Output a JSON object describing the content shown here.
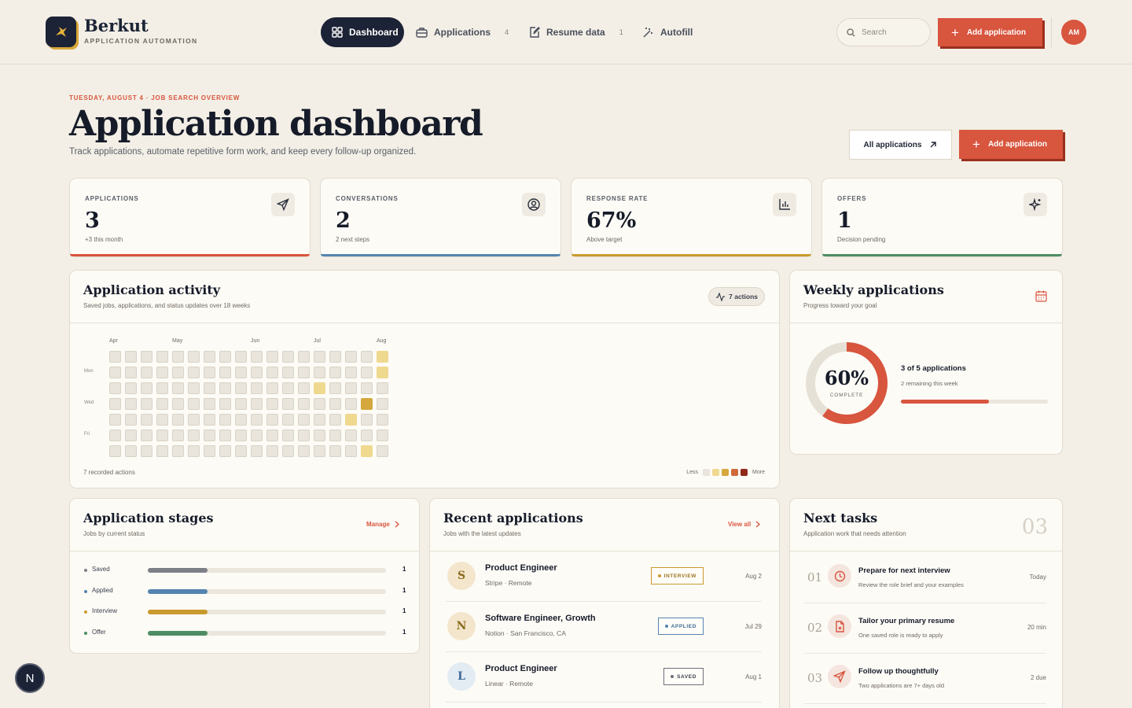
{
  "brand": {
    "name": "Berkut",
    "tagline": "APPLICATION AUTOMATION"
  },
  "nav": {
    "dashboard": "Dashboard",
    "applications": "Applications",
    "applications_count": "4",
    "resume": "Resume data",
    "resume_count": "1",
    "autofill": "Autofill"
  },
  "search": {
    "placeholder": "Search"
  },
  "header": {
    "add_label": "Add application",
    "avatar_initials": "AM"
  },
  "hero": {
    "eyebrow": "TUESDAY, AUGUST 4 · JOB SEARCH OVERVIEW",
    "title": "Application dashboard",
    "subtitle": "Track applications, automate repetitive form work, and keep every follow-up organized.",
    "all_label": "All applications",
    "add_label": "Add application"
  },
  "stats": [
    {
      "label": "APPLICATIONS",
      "value": "3",
      "sub": "+3 this month",
      "icon": "send-icon",
      "color": "#d8553e"
    },
    {
      "label": "CONVERSATIONS",
      "value": "2",
      "sub": "2 next steps",
      "icon": "user-circle-icon",
      "color": "#5584b0"
    },
    {
      "label": "RESPONSE RATE",
      "value": "67%",
      "sub": "Above target",
      "icon": "bar-chart-icon",
      "color": "#c99a2e"
    },
    {
      "label": "OFFERS",
      "value": "1",
      "sub": "Decision pending",
      "icon": "sparkle-icon",
      "color": "#4e8d63"
    }
  ],
  "activity": {
    "title": "Application activity",
    "sub": "Saved jobs, applications, and status updates over 18 weeks",
    "pill": "7 actions",
    "months": [
      "Apr",
      "May",
      "Jun",
      "Jul",
      "Aug"
    ],
    "days": [
      "Mon",
      "Wed",
      "Fri"
    ],
    "footer": "7 recorded actions",
    "legend_less": "Less",
    "legend_more": "More",
    "legend_colors": [
      "#e9e5dc",
      "#efd98f",
      "#d4a83d",
      "#cf6b3a",
      "#8f2a1a"
    ],
    "highlights": [
      {
        "week": 17,
        "day": 0,
        "level": 1
      },
      {
        "week": 17,
        "day": 1,
        "level": 1
      },
      {
        "week": 13,
        "day": 2,
        "level": 1
      },
      {
        "week": 16,
        "day": 3,
        "level": 2
      },
      {
        "week": 15,
        "day": 4,
        "level": 1
      },
      {
        "week": 16,
        "day": 6,
        "level": 1
      }
    ]
  },
  "weekly": {
    "title": "Weekly applications",
    "sub": "Progress toward your goal",
    "percent_label": "60%",
    "complete": "COMPLETE",
    "progress": 0.6,
    "headline": "3 of 5 applications",
    "remaining": "2 remaining this week"
  },
  "stages": {
    "title": "Application stages",
    "sub": "Jobs by current status",
    "manage": "Manage",
    "rows": [
      {
        "name": "Saved",
        "count": "1",
        "fraction": 0.25,
        "color": "#7d7f86"
      },
      {
        "name": "Applied",
        "count": "1",
        "fraction": 0.25,
        "color": "#5584b0"
      },
      {
        "name": "Interview",
        "count": "1",
        "fraction": 0.25,
        "color": "#c99a2e"
      },
      {
        "name": "Offer",
        "count": "1",
        "fraction": 0.25,
        "color": "#4e8d63"
      }
    ]
  },
  "recent": {
    "title": "Recent applications",
    "sub": "Jobs with the latest updates",
    "view_all": "View all",
    "rows": [
      {
        "initial": "S",
        "title": "Product Engineer",
        "meta": "Stripe · Remote",
        "badge": "INTERVIEW",
        "badge_color": "#c99a2e",
        "date": "Aug 2",
        "avatar_bg": "#f3e6cc",
        "avatar_fg": "#8c6a1e"
      },
      {
        "initial": "N",
        "title": "Software Engineer, Growth",
        "meta": "Notion · San Francisco, CA",
        "badge": "APPLIED",
        "badge_color": "#5584b0",
        "date": "Jul 29",
        "avatar_bg": "#f3e6cc",
        "avatar_fg": "#8c6a1e"
      },
      {
        "initial": "L",
        "title": "Product Engineer",
        "meta": "Linear · Remote",
        "badge": "SAVED",
        "badge_color": "#6f7178",
        "date": "Aug 1",
        "avatar_bg": "#e3ebf3",
        "avatar_fg": "#3d6a96"
      }
    ]
  },
  "tasks": {
    "title": "Next tasks",
    "sub": "Application work that needs attention",
    "count": "03",
    "rows": [
      {
        "num": "01",
        "title": "Prepare for next interview",
        "sub": "Review the role brief and your examples",
        "due": "Today",
        "icon": "clock-icon"
      },
      {
        "num": "02",
        "title": "Tailor your primary resume",
        "sub": "One saved role is ready to apply",
        "due": "20 min",
        "icon": "document-icon"
      },
      {
        "num": "03",
        "title": "Follow up thoughtfully",
        "sub": "Two applications are 7+ days old",
        "due": "2 due",
        "icon": "send-icon"
      }
    ]
  },
  "fab": {
    "label": "N"
  }
}
